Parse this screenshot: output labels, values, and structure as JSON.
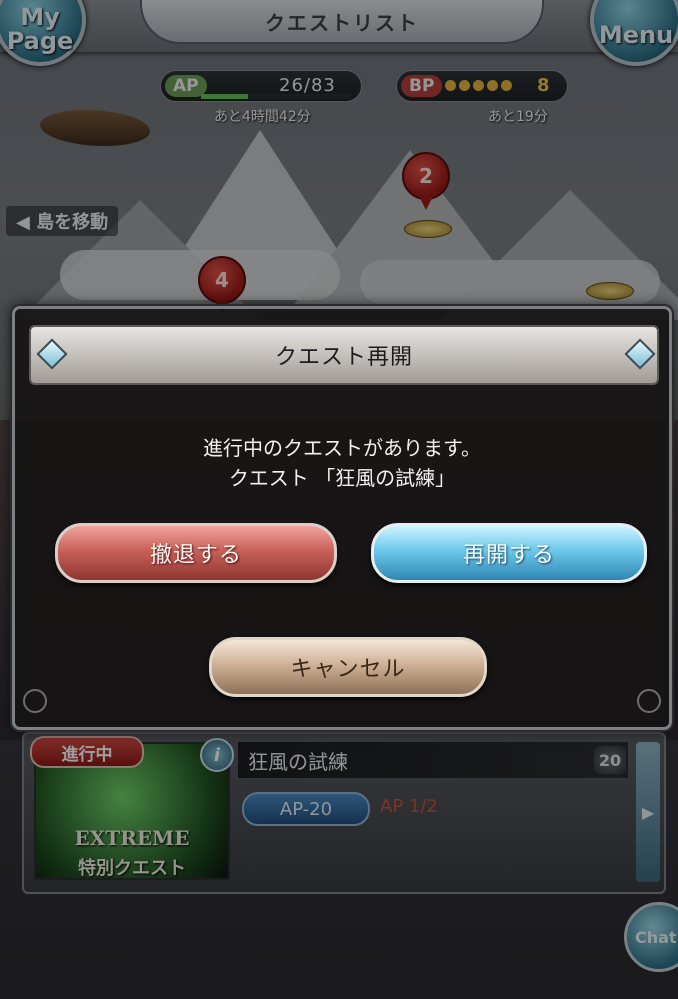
{
  "header": {
    "title": "クエストリスト",
    "mypage_label_line1": "My",
    "mypage_label_line2": "Page",
    "menu_label": "Menu"
  },
  "stats": {
    "ap_label": "AP",
    "ap_value": "26/83",
    "ap_fill": 0.31,
    "ap_recover": "あと4時間42分",
    "bp_label": "BP",
    "bp_value": "8",
    "bp_recover": "あと19分"
  },
  "map": {
    "move_island": "◀ 島を移動",
    "pins": [
      "2",
      "4"
    ]
  },
  "dialog": {
    "title": "クエスト再開",
    "message_line1": "進行中のクエストがあります。",
    "message_line2": "クエスト 「狂風の試練」",
    "retreat_label": "撤退する",
    "resume_label": "再開する",
    "cancel_label": "キャンセル"
  },
  "quest_card": {
    "status": "進行中",
    "info": "i",
    "name": "狂風の試練",
    "level": "20",
    "ap_cost": "AP-20",
    "ap_note": "AP 1/2",
    "thumb_caption1": "EXTREME",
    "thumb_caption2": "特別クエスト"
  },
  "chat_label": "Chat",
  "colors": {
    "retreat": "#c8615a",
    "resume": "#6cc8ea",
    "cancel": "#cfb197",
    "badge": "#d44a43"
  }
}
